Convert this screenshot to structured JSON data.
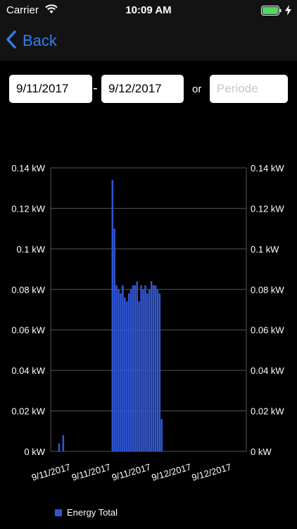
{
  "status_bar": {
    "carrier": "Carrier",
    "time": "10:09 AM",
    "wifi_icon": "wifi-icon",
    "battery_icon": "battery-icon",
    "charging_icon": "lightning-bolt-icon"
  },
  "nav": {
    "back_label": "Back",
    "back_icon": "chevron-left-icon"
  },
  "filter": {
    "start_date": "9/11/2017",
    "separator": "-",
    "end_date": "9/12/2017",
    "or_label": "or",
    "periode_placeholder": "Periode"
  },
  "colors": {
    "accent": "#2f80ed",
    "bar": "#3056d3",
    "grid": "#555555",
    "background": "#000000"
  },
  "chart_data": {
    "type": "bar",
    "y_tick_labels": [
      "0 kW",
      "0.02 kW",
      "0.04 kW",
      "0.06 kW",
      "0.08 kW",
      "0.1 kW",
      "0.12 kW",
      "0.14 kW"
    ],
    "ylim": [
      0,
      0.14
    ],
    "y_unit": "kW",
    "x_tick_labels": [
      "9/11/2017",
      "9/11/2017",
      "9/11/2017",
      "9/12/2017",
      "9/12/2017"
    ],
    "grid": true,
    "legend_position": "bottom-left",
    "series": [
      {
        "name": "Energy Total",
        "values": [
          0,
          0,
          0,
          0.004,
          0,
          0.008,
          0,
          0,
          0,
          0,
          0,
          0,
          0,
          0,
          0,
          0,
          0,
          0,
          0,
          0,
          0,
          0,
          0,
          0,
          0,
          0,
          0,
          0,
          0,
          0.134,
          0.11,
          0.082,
          0.08,
          0.078,
          0.082,
          0.076,
          0.074,
          0.078,
          0.08,
          0.082,
          0.082,
          0.084,
          0.074,
          0.082,
          0.08,
          0.082,
          0.078,
          0.08,
          0.084,
          0.082,
          0.082,
          0.08,
          0.078,
          0.016,
          0,
          0,
          0,
          0,
          0,
          0,
          0,
          0,
          0,
          0,
          0,
          0,
          0,
          0,
          0,
          0,
          0,
          0,
          0,
          0,
          0,
          0,
          0,
          0,
          0,
          0,
          0,
          0,
          0,
          0,
          0,
          0,
          0,
          0,
          0,
          0,
          0,
          0,
          0,
          0
        ]
      }
    ]
  }
}
